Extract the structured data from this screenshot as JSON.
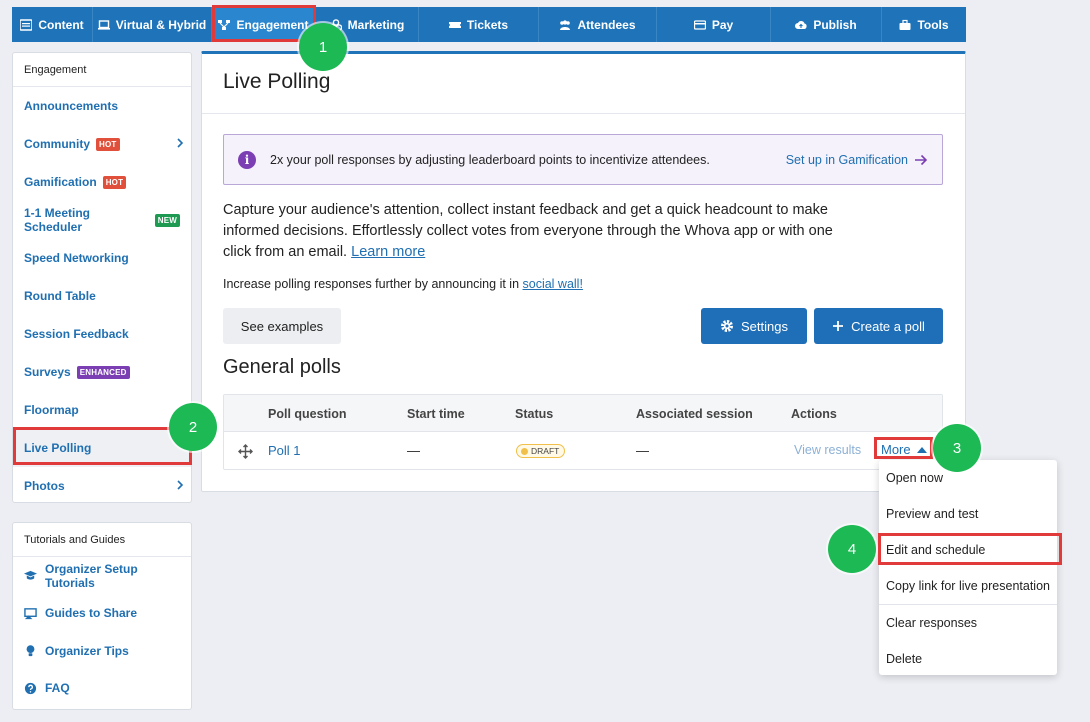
{
  "topnav": [
    {
      "label": "Content",
      "icon": "content-icon"
    },
    {
      "label": "Virtual & Hybrid",
      "icon": "laptop-icon"
    },
    {
      "label": "Engagement",
      "icon": "network-icon"
    },
    {
      "label": "Marketing",
      "icon": "marketing-icon"
    },
    {
      "label": "Tickets",
      "icon": "ticket-icon"
    },
    {
      "label": "Attendees",
      "icon": "people-icon"
    },
    {
      "label": "Pay",
      "icon": "card-icon"
    },
    {
      "label": "Publish",
      "icon": "cloud-upload-icon"
    },
    {
      "label": "Tools",
      "icon": "toolbox-icon"
    }
  ],
  "steps": [
    "1",
    "2",
    "3",
    "4"
  ],
  "sidebar": {
    "header": "Engagement",
    "items": [
      {
        "label": "Announcements"
      },
      {
        "label": "Community",
        "badge": "HOT"
      },
      {
        "label": "Gamification",
        "badge": "HOT"
      },
      {
        "label": "1-1 Meeting Scheduler",
        "badge": "NEW"
      },
      {
        "label": "Speed Networking"
      },
      {
        "label": "Round Table"
      },
      {
        "label": "Session Feedback"
      },
      {
        "label": "Surveys",
        "badge": "ENHANCED"
      },
      {
        "label": "Floormap"
      },
      {
        "label": "Live Polling"
      },
      {
        "label": "Photos"
      }
    ]
  },
  "tutorials": {
    "header": "Tutorials and Guides",
    "items": [
      {
        "label": "Organizer Setup Tutorials",
        "icon": "graduation-cap-icon"
      },
      {
        "label": "Guides to Share",
        "icon": "share-guide-icon"
      },
      {
        "label": "Organizer Tips",
        "icon": "lightbulb-icon"
      },
      {
        "label": "FAQ",
        "icon": "question-circle-icon"
      }
    ]
  },
  "main": {
    "title": "Live Polling",
    "info": {
      "text": "2x your poll responses by adjusting leaderboard points to incentivize attendees.",
      "link": "Set up in Gamification"
    },
    "description": "Capture your audience's attention, collect instant feedback and get a quick headcount to make informed decisions. Effortlessly collect votes from everyone through the Whova app or with one click from an email.",
    "learn_more": "Learn more",
    "increase_text": "Increase polling responses further by announcing it in",
    "social_wall": "social wall!",
    "see_examples": "See examples",
    "settings": "Settings",
    "create_poll": "Create a poll",
    "section_title": "General polls",
    "table": {
      "headers": [
        "Poll question",
        "Start time",
        "Status",
        "Associated session",
        "Actions"
      ],
      "row": {
        "question": "Poll 1",
        "start_time": "—",
        "status": "DRAFT",
        "session": "—",
        "view_results": "View results",
        "more": "More"
      }
    }
  },
  "menu": [
    "Open now",
    "Preview and test",
    "Edit and schedule",
    "Copy link for live presentation",
    "Clear responses",
    "Delete"
  ]
}
